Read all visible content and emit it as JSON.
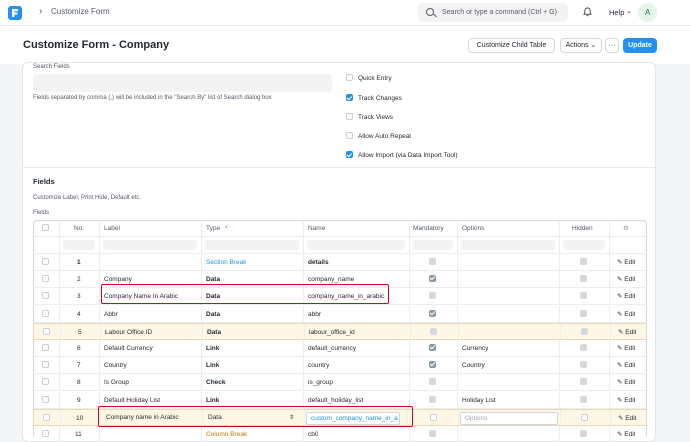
{
  "navbar": {
    "breadcrumb": "Customize Form",
    "search_placeholder": "Search or type a command (Ctrl + G)",
    "help_label": "Help",
    "avatar_initial": "A"
  },
  "page": {
    "title": "Customize Form - Company",
    "btn_child_table": "Customize Child Table",
    "btn_actions": "Actions",
    "btn_more": "···",
    "btn_update": "Update"
  },
  "settings": {
    "search_fields_label": "Search Fields",
    "search_fields_help": "Fields separated by comma (,) will be included in the \"Search By\" list of Search dialog box",
    "checks": [
      {
        "label": "Quick Entry",
        "checked": false
      },
      {
        "label": "Track Changes",
        "checked": true
      },
      {
        "label": "Track Views",
        "checked": false
      },
      {
        "label": "Allow Auto Repeat",
        "checked": false
      },
      {
        "label": "Allow Import (via Data Import Tool)",
        "checked": true
      }
    ]
  },
  "fields_section": {
    "heading": "Fields",
    "subtitle": "Customize Label, Print Hide, Default etc.",
    "grid_label": "Fields",
    "columns": {
      "no": "No.",
      "label": "Label",
      "type": "Type",
      "type_req": "*",
      "name": "Name",
      "mandatory": "Mandatory",
      "options": "Options",
      "hidden": "Hidden"
    },
    "edit_label": "Edit",
    "rows": [
      {
        "no": "1",
        "label": "",
        "type": "Section Break",
        "name": "details",
        "mandatory": false,
        "options": "",
        "hidden": false
      },
      {
        "no": "2",
        "label": "Company",
        "type": "Data",
        "name": "company_name",
        "mandatory": true,
        "options": "",
        "hidden": false
      },
      {
        "no": "3",
        "label": "Company Name In Arabic",
        "type": "Data",
        "name": "company_name_in_arabic",
        "mandatory": false,
        "options": "",
        "hidden": false
      },
      {
        "no": "4",
        "label": "Abbr",
        "type": "Data",
        "name": "abbr",
        "mandatory": true,
        "options": "",
        "hidden": false
      },
      {
        "no": "5",
        "label": "Labour Office ID",
        "type": "Data",
        "name": "labour_office_id",
        "mandatory": false,
        "options": "",
        "hidden": false
      },
      {
        "no": "6",
        "label": "Default Currency",
        "type": "Link",
        "name": "default_currency",
        "mandatory": true,
        "options": "Currency",
        "hidden": false
      },
      {
        "no": "7",
        "label": "Country",
        "type": "Link",
        "name": "country",
        "mandatory": true,
        "options": "Country",
        "hidden": false
      },
      {
        "no": "8",
        "label": "Is Group",
        "type": "Check",
        "name": "is_group",
        "mandatory": false,
        "options": "",
        "hidden": false
      },
      {
        "no": "9",
        "label": "Default Holiday List",
        "type": "Link",
        "name": "default_holiday_list",
        "mandatory": false,
        "options": "Holiday List",
        "hidden": false
      },
      {
        "no": "10",
        "label": "Company name in Arabic",
        "type": "Data",
        "name": "custom_company_name_in_a",
        "mandatory": false,
        "options": "Options",
        "hidden": false
      },
      {
        "no": "11",
        "label": "",
        "type": "Column Break",
        "name": "cb0",
        "mandatory": false,
        "options": "",
        "hidden": false
      }
    ]
  }
}
